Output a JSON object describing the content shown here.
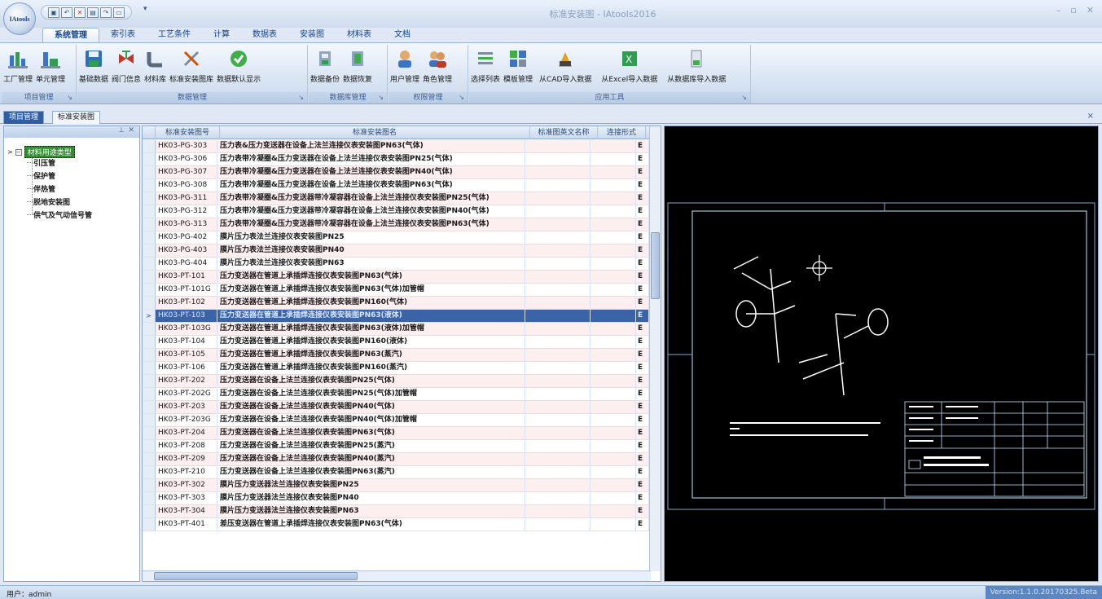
{
  "window": {
    "title": "标准安装图 - IAtools2016",
    "app_logo_text": "IAtools",
    "minimize": "–",
    "restore": "▫",
    "close": "✕"
  },
  "quick_access": [
    "▣",
    "↶",
    "✕",
    "▤",
    "↷",
    "▭"
  ],
  "tabs": [
    {
      "label": "系统管理",
      "active": true
    },
    {
      "label": "索引表"
    },
    {
      "label": "工艺条件"
    },
    {
      "label": "计算"
    },
    {
      "label": "数据表"
    },
    {
      "label": "安装图"
    },
    {
      "label": "材料表"
    },
    {
      "label": "文档"
    }
  ],
  "ribbon": {
    "groups": [
      {
        "name": "项目管理",
        "buttons": [
          "工厂管理",
          "单元管理"
        ]
      },
      {
        "name": "数据管理",
        "buttons": [
          "基础数据",
          "阀门信息",
          "材料库",
          "标准安装图库",
          "数据默认显示"
        ]
      },
      {
        "name": "数据库管理",
        "buttons": [
          "数据备份",
          "数据恢复"
        ]
      },
      {
        "name": "权限管理",
        "buttons": [
          "用户管理",
          "角色管理"
        ]
      },
      {
        "name": "应用工具",
        "buttons": [
          "选择列表",
          "模板管理",
          "从CAD导入数据",
          "从Excel导入数据",
          "从数据库导入数据"
        ]
      }
    ],
    "launcher": "↘"
  },
  "doc_tabs": {
    "tab1": "项目管理",
    "tab2": "标准安装图",
    "close": "×"
  },
  "tree": {
    "header_pin": "⊥",
    "header_close": "✕",
    "root": "材料用途类型",
    "children": [
      "引压管",
      "保护管",
      "伴热管",
      "脱地安装图",
      "供气及气动信号管"
    ]
  },
  "table": {
    "columns": [
      "标准安装图号",
      "标准安装图名",
      "标准图英文名称",
      "连接形式"
    ],
    "selected_index": 13,
    "rows": [
      [
        "HK03-PG-303",
        "压力表&压力变送器在设备上法兰连接仪表安装图PN63(气体)"
      ],
      [
        "HK03-PG-306",
        "压力表带冷凝圈&压力变送器在设备上法兰连接仪表安装图PN25(气体)"
      ],
      [
        "HK03-PG-307",
        "压力表带冷凝圈&压力变送器在设备上法兰连接仪表安装图PN40(气体)"
      ],
      [
        "HK03-PG-308",
        "压力表带冷凝圈&压力变送器在设备上法兰连接仪表安装图PN63(气体)"
      ],
      [
        "HK03-PG-311",
        "压力表带冷凝圈&压力变送器带冷凝容器在设备上法兰连接仪表安装图PN25(气体)"
      ],
      [
        "HK03-PG-312",
        "压力表带冷凝圈&压力变送器带冷凝容器在设备上法兰连接仪表安装图PN40(气体)"
      ],
      [
        "HK03-PG-313",
        "压力表带冷凝圈&压力变送器带冷凝容器在设备上法兰连接仪表安装图PN63(气体)"
      ],
      [
        "HK03-PG-402",
        "膜片压力表法兰连接仪表安装图PN25"
      ],
      [
        "HK03-PG-403",
        "膜片压力表法兰连接仪表安装图PN40"
      ],
      [
        "HK03-PG-404",
        "膜片压力表法兰连接仪表安装图PN63"
      ],
      [
        "HK03-PT-101",
        "压力变送器在管道上承插焊连接仪表安装图PN63(气体)"
      ],
      [
        "HK03-PT-101G",
        "压力变送器在管道上承插焊连接仪表安装图PN63(气体)加管帽"
      ],
      [
        "HK03-PT-102",
        "压力变送器在管道上承插焊连接仪表安装图PN160(气体)"
      ],
      [
        "HK03-PT-103",
        "压力变送器在管道上承插焊连接仪表安装图PN63(液体)"
      ],
      [
        "HK03-PT-103G",
        "压力变送器在管道上承插焊连接仪表安装图PN63(液体)加管帽"
      ],
      [
        "HK03-PT-104",
        "压力变送器在管道上承插焊连接仪表安装图PN160(液体)"
      ],
      [
        "HK03-PT-105",
        "压力变送器在管道上承插焊连接仪表安装图PN63(蒸汽)"
      ],
      [
        "HK03-PT-106",
        "压力变送器在管道上承插焊连接仪表安装图PN160(蒸汽)"
      ],
      [
        "HK03-PT-202",
        "压力变送器在设备上法兰连接仪表安装图PN25(气体)"
      ],
      [
        "HK03-PT-202G",
        "压力变送器在设备上法兰连接仪表安装图PN25(气体)加管帽"
      ],
      [
        "HK03-PT-203",
        "压力变送器在设备上法兰连接仪表安装图PN40(气体)"
      ],
      [
        "HK03-PT-203G",
        "压力变送器在设备上法兰连接仪表安装图PN40(气体)加管帽"
      ],
      [
        "HK03-PT-204",
        "压力变送器在设备上法兰连接仪表安装图PN63(气体)"
      ],
      [
        "HK03-PT-208",
        "压力变送器在设备上法兰连接仪表安装图PN25(蒸汽)"
      ],
      [
        "HK03-PT-209",
        "压力变送器在设备上法兰连接仪表安装图PN40(蒸汽)"
      ],
      [
        "HK03-PT-210",
        "压力变送器在设备上法兰连接仪表安装图PN63(蒸汽)"
      ],
      [
        "HK03-PT-302",
        "膜片压力变送器法兰连接仪表安装图PN25"
      ],
      [
        "HK03-PT-303",
        "膜片压力变送器法兰连接仪表安装图PN40"
      ],
      [
        "HK03-PT-304",
        "膜片压力变送器法兰连接仪表安装图PN63"
      ],
      [
        "HK03-PT-401",
        "差压变送器在管道上承插焊连接仪表安装图PN63(气体)"
      ]
    ],
    "extra_char": "E"
  },
  "status": {
    "user": "用户：admin",
    "version": "Version:1.1.0.20170325.Beta"
  }
}
